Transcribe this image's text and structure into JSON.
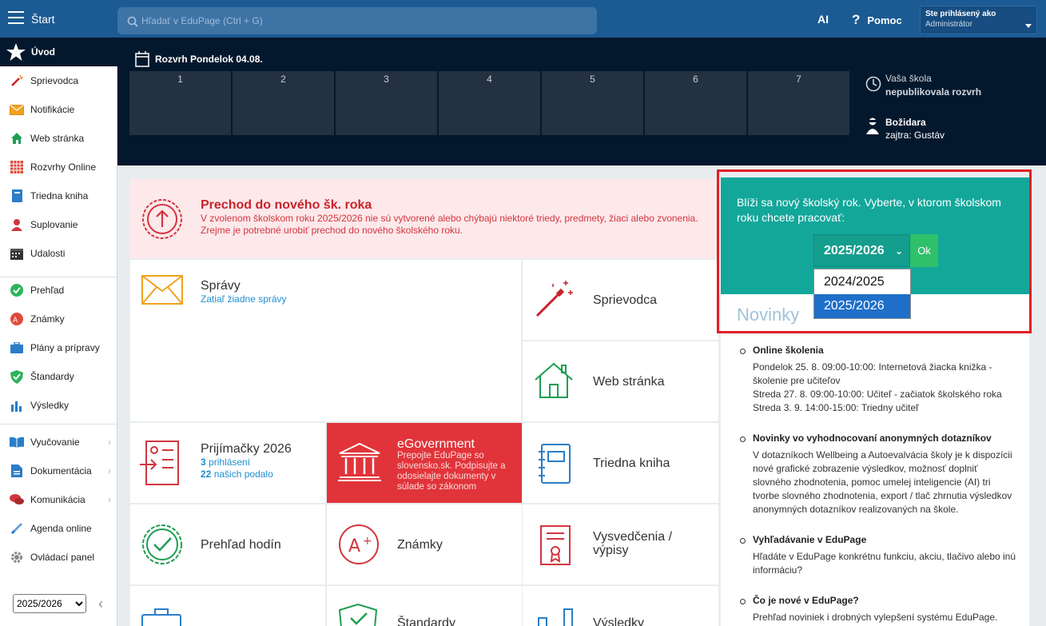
{
  "topbar": {
    "start": "Štart",
    "search_placeholder": "Hľadať v EduPage (Ctrl + G)",
    "ai": "AI",
    "help": "Pomoc",
    "user_line1": "Ste prihlásený ako",
    "user_line2": "Administrátor"
  },
  "sidebar": {
    "active": "Úvod",
    "items": [
      {
        "label": "Sprievodca"
      },
      {
        "label": "Notifikácie"
      },
      {
        "label": "Web stránka"
      },
      {
        "label": "Rozvrhy Online"
      },
      {
        "label": "Triedna kniha"
      },
      {
        "label": "Suplovanie"
      },
      {
        "label": "Udalosti"
      },
      {
        "label": "Prehľad"
      },
      {
        "label": "Známky"
      },
      {
        "label": "Plány a prípravy"
      },
      {
        "label": "Štandardy"
      },
      {
        "label": "Výsledky"
      },
      {
        "label": "Vyučovanie"
      },
      {
        "label": "Dokumentácia"
      },
      {
        "label": "Komunikácia"
      },
      {
        "label": "Agenda online"
      },
      {
        "label": "Ovládací panel"
      }
    ],
    "year": "2025/2026"
  },
  "timetable": {
    "title": "Rozvrh Pondelok 04.08.",
    "periods": [
      "1",
      "2",
      "3",
      "4",
      "5",
      "6",
      "7"
    ],
    "info1_a": "Vaša škola",
    "info1_b": "nepublikovala rozvrh",
    "info2_a": "Božidara",
    "info2_b": "zajtra: Gustáv"
  },
  "notice": {
    "title": "Prechod do nového šk. roka",
    "body": "V zvolenom školskom roku 2025/2026 nie sú vytvorené alebo chýbajú niektoré triedy, predmety, žiaci alebo zvonenia. Zrejme je potrebné urobiť prechod do nového školského roku."
  },
  "tiles": {
    "spravy_title": "Správy",
    "spravy_sub": "Zatiaľ žiadne správy",
    "sprievodca": "Sprievodca",
    "web": "Web stránka",
    "prijimacky_title": "Prijímačky 2026",
    "prijimacky_n1": "3",
    "prijimacky_t1": "prihlásení",
    "prijimacky_n2": "22",
    "prijimacky_t2": "našich podalo",
    "egov_title": "eGovernment",
    "egov_desc": "Prepojte EduPage so slovensko.sk. Podpisujte a odosielajte dokumenty v súlade so zákonom",
    "triedna": "Triedna kniha",
    "prehlad": "Prehľad hodín",
    "znamky": "Známky",
    "vysvedcenia": "Vysvedčenia / výpisy",
    "bottom2": "Štandardy",
    "bottom3": "Výsledky"
  },
  "yearpanel": {
    "message": "Blíži sa nový školský rok. Vyberte, v ktorom školskom roku chcete pracovať:",
    "selected": "2025/2026",
    "ok": "Ok",
    "options": [
      "2024/2025",
      "2025/2026"
    ]
  },
  "news": {
    "heading": "Novinky",
    "items": [
      {
        "title": "Online školenia",
        "body": "Pondelok 25. 8. 09:00-10:00: Internetová žiacka knižka - školenie pre učiteľov\nStreda 27. 8. 09:00-10:00: Učiteľ - začiatok školského roka\nStreda 3. 9. 14:00-15:00: Triedny učiteľ"
      },
      {
        "title": "Novinky vo vyhodnocovaní anonymných dotazníkov",
        "body": "V dotazníkoch Wellbeing a Autoevalvácia školy je k dispozícii nové grafické zobrazenie výsledkov, možnosť doplniť slovného zhodnotenia, pomoc umelej inteligencie (AI) tri tvorbe slovného zhodnotenia, export / tlač zhrnutia výsledkov anonymných dotazníkov realizovaných na škole."
      },
      {
        "title": "Vyhľadávanie v EduPage",
        "body": "Hľadáte v EduPage konkrétnu funkciu, akciu, tlačivo alebo inú informáciu?"
      },
      {
        "title": "Čo je nové v EduPage?",
        "body": "Prehľad noviniek i drobných vylepšení systému EduPage."
      }
    ]
  },
  "colors": {
    "topbar": "#1b5a93",
    "dark": "#04182d",
    "teal": "#13a79a",
    "red": "#e1343a",
    "link": "#1e8fd0"
  }
}
